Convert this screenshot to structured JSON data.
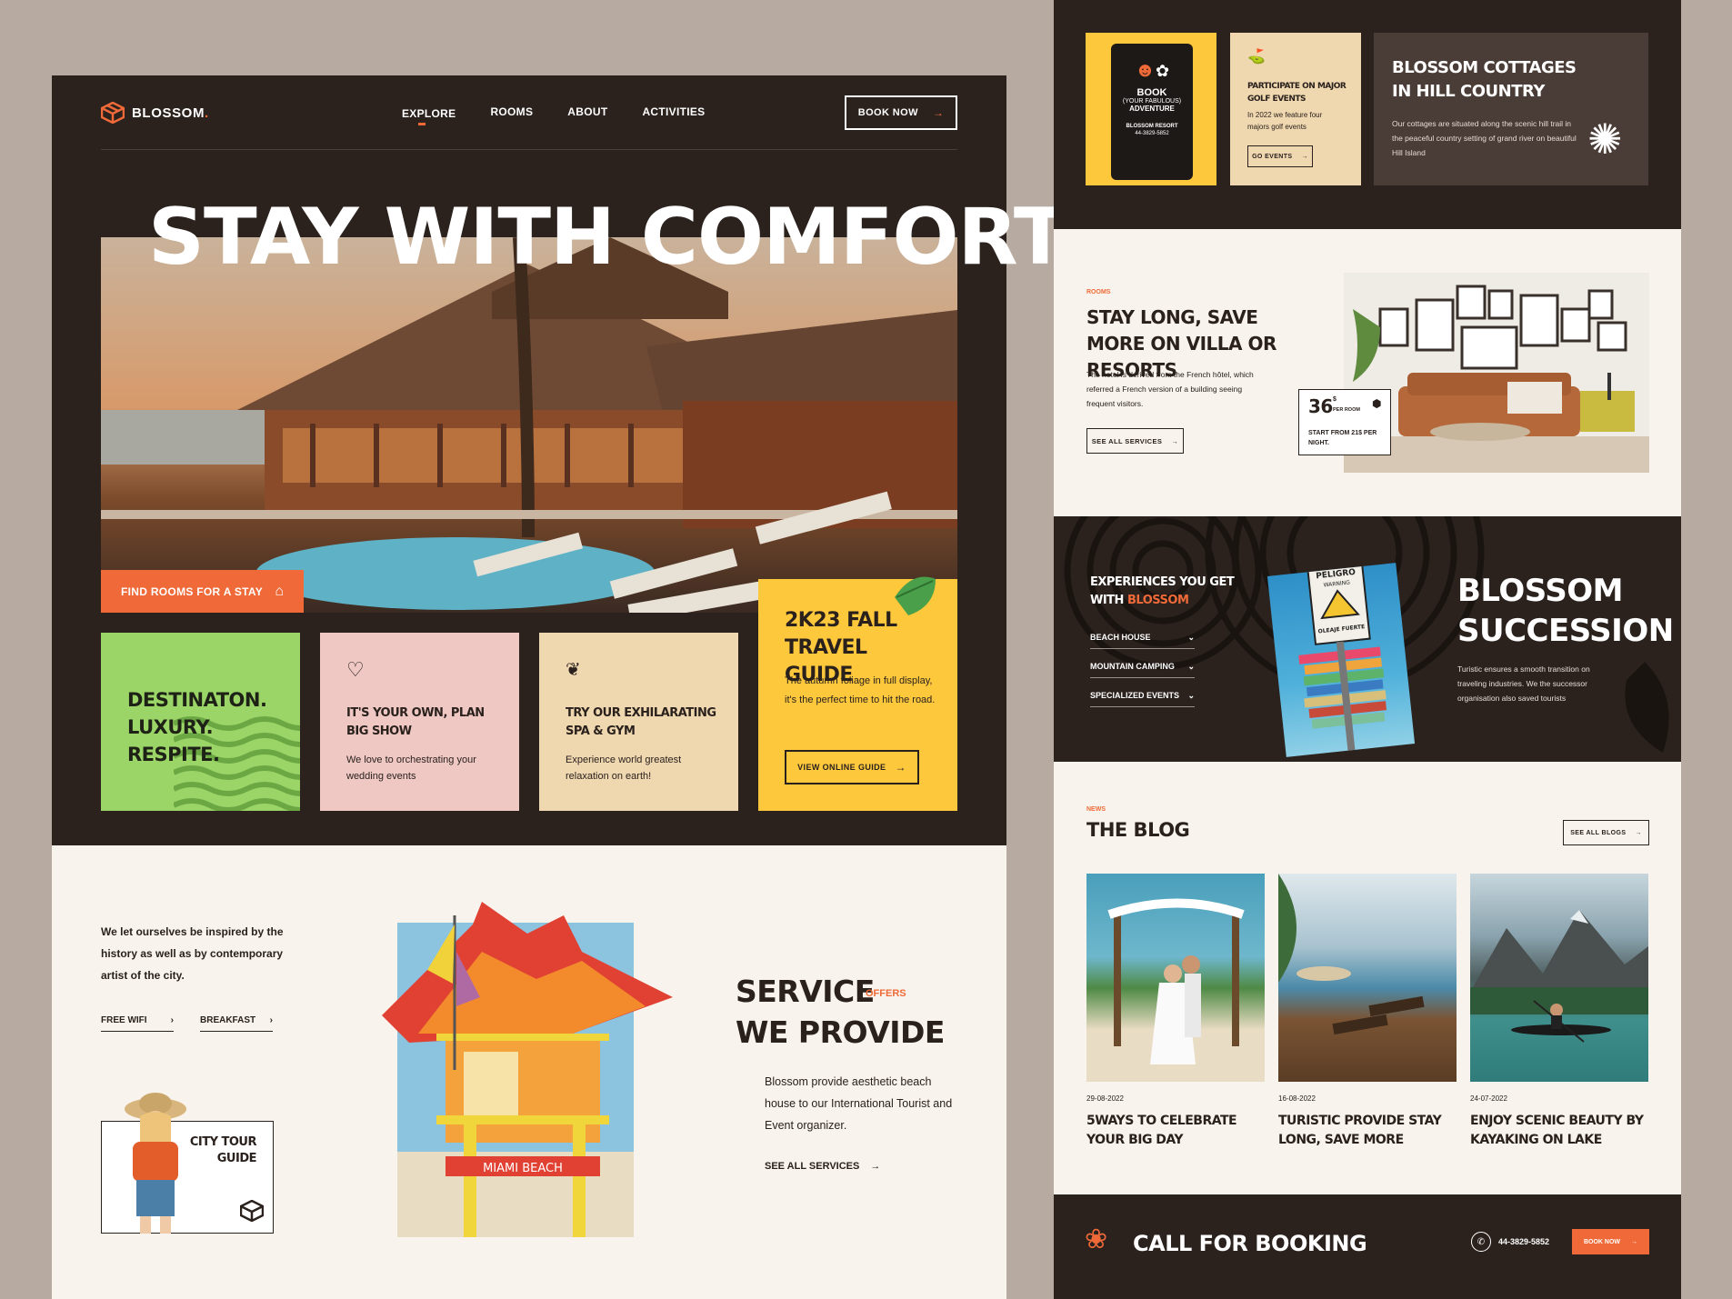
{
  "brand": {
    "name": "BLOSSOM",
    "dot": "."
  },
  "nav": {
    "items": [
      "EXPLORE",
      "ROOMS",
      "ABOUT",
      "ACTIVITIES"
    ],
    "book_now": "BOOK NOW"
  },
  "hero": {
    "title": "STAY WITH COMFORT",
    "find_rooms": "FIND ROOMS FOR A STAY"
  },
  "cards": {
    "green": {
      "title": "DESTINATON. LUXURY. RESPITE."
    },
    "pink": {
      "title": "IT'S YOUR OWN, PLAN BIG SHOW",
      "body": "We love to orchestrating your wedding events"
    },
    "tan": {
      "title": "TRY OUR EXHILARATING SPA & GYM",
      "body": "Experience world greatest relaxation on earth!"
    },
    "yellow": {
      "title": "2K23 FALL TRAVEL GUIDE",
      "body": "The autumn foliage in full display, it's the perfect time to hit the road.",
      "button": "VIEW ONLINE GUIDE"
    }
  },
  "inspired": {
    "text": "We let ourselves be inspired by the history as well as by contemporary artist of the city.",
    "links": [
      "FREE WIFI",
      "BREAKFAST"
    ]
  },
  "city_tour": {
    "label": "CITY TOUR GUIDE"
  },
  "lifeguard": {
    "sign": "MIAMI BEACH"
  },
  "service": {
    "title_1": "SERVICE",
    "tag": "OFFERS",
    "title_2": "WE PROVIDE",
    "body": "Blossom provide aesthetic beach house to our International Tourist and Event organizer.",
    "link": "SEE ALL SERVICES"
  },
  "promo": {
    "sign": {
      "line1": "BOOK",
      "line2": "(YOUR FABULOUS)",
      "line3": "ADVENTURE",
      "brand": "BLOSSOM RESORT",
      "phone": "44-3829-5852"
    },
    "golf": {
      "title": "PARTICIPATE ON MAJOR GOLF EVENTS",
      "body": "In 2022 we feature four majors golf events",
      "button": "GO EVENTS"
    },
    "cottages": {
      "title": "BLOSSOM COTTAGES IN HILL COUNTRY",
      "body": "Our cottages are situated along the scenic hill trail in the peaceful country setting of grand river on beautiful Hill Island"
    }
  },
  "rooms": {
    "tag": "ROOMS",
    "title": "STAY LONG, SAVE MORE ON VILLA OR RESORTS",
    "body": "The hotel is derived from the French hôtel, which referred a French version of a building seeing frequent visitors.",
    "button": "SEE ALL SERVICES",
    "price": {
      "amount": "36",
      "currency": "$",
      "unit": "PER ROOM",
      "note": "START FROM 21$ PER NIGHT."
    }
  },
  "experiences": {
    "title_1": "EXPERIENCES YOU GET",
    "title_2": "WITH",
    "title_brand": "BLOSSOM",
    "items": [
      "BEACH HOUSE",
      "MOUNTAIN CAMPING",
      "SPECIALIZED EVENTS"
    ],
    "sign": {
      "top": "PELIGRO",
      "sub": "WARNING",
      "bottom": "OLEAJE FUERTE"
    },
    "succession_title": "BLOSSOM SUCCESSION",
    "succession_body": "Turistic ensures a smooth transition on traveling industries. We the successor organisation also saved tourists"
  },
  "blog": {
    "tag": "NEWS",
    "title": "THE BLOG",
    "button": "SEE ALL BLOGS",
    "posts": [
      {
        "date": "29-08-2022",
        "title": "5WAYS TO CELEBRATE YOUR BIG DAY"
      },
      {
        "date": "16-08-2022",
        "title": "TURISTIC PROVIDE STAY LONG, SAVE MORE"
      },
      {
        "date": "24-07-2022",
        "title": "ENJOY SCENIC BEAUTY BY KAYAKING ON LAKE"
      }
    ]
  },
  "booking": {
    "title": "CALL FOR BOOKING",
    "phone": "44-3829-5852",
    "button": "BOOK NOW"
  },
  "colors": {
    "orange": "#ef6a38",
    "dark": "#2b221e",
    "cream": "#f8f3ec",
    "green": "#9bd467",
    "pink": "#efc8c4",
    "tan": "#efd7b0",
    "yellow": "#fec83c"
  }
}
